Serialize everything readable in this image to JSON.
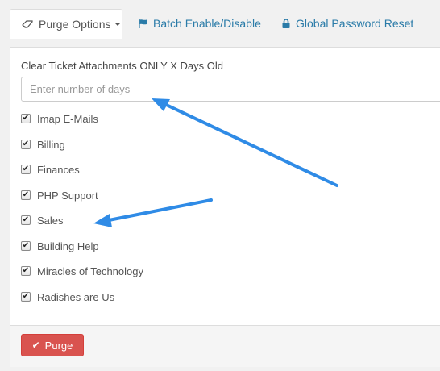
{
  "tabs": [
    {
      "label": "Purge Options",
      "icon": "eraser-icon",
      "active": true
    },
    {
      "label": "Batch Enable/Disable",
      "icon": "flag-icon",
      "active": false
    },
    {
      "label": "Global Password Reset",
      "icon": "lock-icon",
      "active": false
    }
  ],
  "purge": {
    "field_label": "Clear Ticket Attachments ONLY X Days Old",
    "days_placeholder": "Enter number of days",
    "days_value": ""
  },
  "departments": [
    {
      "label": "Imap E-Mails",
      "checked": true
    },
    {
      "label": "Billing",
      "checked": true
    },
    {
      "label": "Finances",
      "checked": true
    },
    {
      "label": "PHP Support",
      "checked": true
    },
    {
      "label": "Sales",
      "checked": true
    },
    {
      "label": "Building Help",
      "checked": true
    },
    {
      "label": "Miracles of Technology",
      "checked": true
    },
    {
      "label": "Radishes are Us",
      "checked": true
    }
  ],
  "footer": {
    "purge_label": "Purge",
    "purge_icon": "check-icon"
  },
  "colors": {
    "link": "#2a7ba8",
    "danger": "#d9534f",
    "arrow": "#2f8be6"
  }
}
